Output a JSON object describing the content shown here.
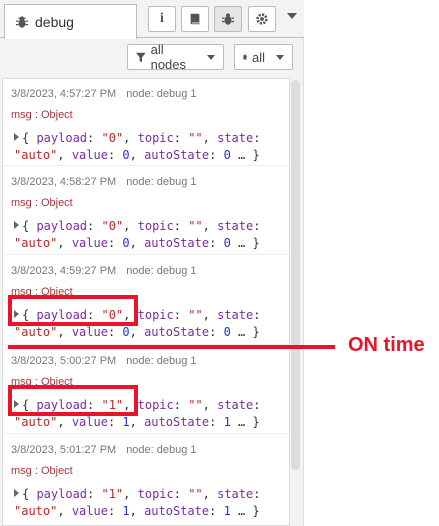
{
  "sidebar": {
    "tab_label": "debug",
    "tab_buttons": [
      {
        "name": "info",
        "glyph": "i"
      },
      {
        "name": "book",
        "glyph": ""
      },
      {
        "name": "debug",
        "glyph": ""
      },
      {
        "name": "settings",
        "glyph": ""
      }
    ],
    "filter_nodes_label": "all nodes",
    "clear_label": "all"
  },
  "messages": [
    {
      "timestamp": "3/8/2023, 4:57:27 PM",
      "node": "node: debug 1",
      "type": "msg : Object",
      "payload": "\"0\"",
      "topic": "\"\"",
      "state": "\"auto\"",
      "value": "0",
      "autoState": "0"
    },
    {
      "timestamp": "3/8/2023, 4:58:27 PM",
      "node": "node: debug 1",
      "type": "msg : Object",
      "payload": "\"0\"",
      "topic": "\"\"",
      "state": "\"auto\"",
      "value": "0",
      "autoState": "0"
    },
    {
      "timestamp": "3/8/2023, 4:59:27 PM",
      "node": "node: debug 1",
      "type": "msg : Object",
      "payload": "\"0\"",
      "topic": "\"\"",
      "state": "\"auto\"",
      "value": "0",
      "autoState": "0"
    },
    {
      "timestamp": "3/8/2023, 5:00:27 PM",
      "node": "node: debug 1",
      "type": "msg : Object",
      "payload": "\"1\"",
      "topic": "\"\"",
      "state": "\"auto\"",
      "value": "1",
      "autoState": "1"
    },
    {
      "timestamp": "3/8/2023, 5:01:27 PM",
      "node": "node: debug 1",
      "type": "msg : Object",
      "payload": "\"1\"",
      "topic": "\"\"",
      "state": "\"auto\"",
      "value": "1",
      "autoState": "1"
    }
  ],
  "annotation": {
    "label": "ON time",
    "color": "#e8152a"
  }
}
